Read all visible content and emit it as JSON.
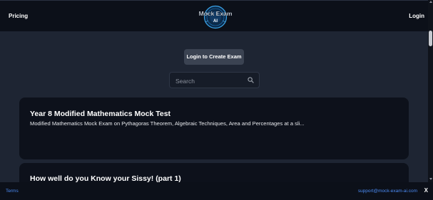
{
  "header": {
    "left_link": "Pricing",
    "right_link": "Login",
    "logo": {
      "line1": "Mock Exam",
      "line2": "AI"
    }
  },
  "actions": {
    "login_create": "Login to Create Exam"
  },
  "search": {
    "placeholder": "Search"
  },
  "exams": [
    {
      "title": "Year 8 Modified Mathematics Mock Test",
      "description": "Modified Mathematics Mock Exam on Pythagoras Theorem, Algebraic Techniques, Area and Percentages at a sli..."
    },
    {
      "title": "How well do you Know your Sissy! (part 1)",
      "description": ""
    }
  ],
  "footer": {
    "terms": "Terms",
    "email": "support@mock-exam-ai.com",
    "close": "X"
  },
  "colors": {
    "background": "#1e2533",
    "header": "#0c1019",
    "card": "#0d111b",
    "link": "#4b8bf5"
  }
}
